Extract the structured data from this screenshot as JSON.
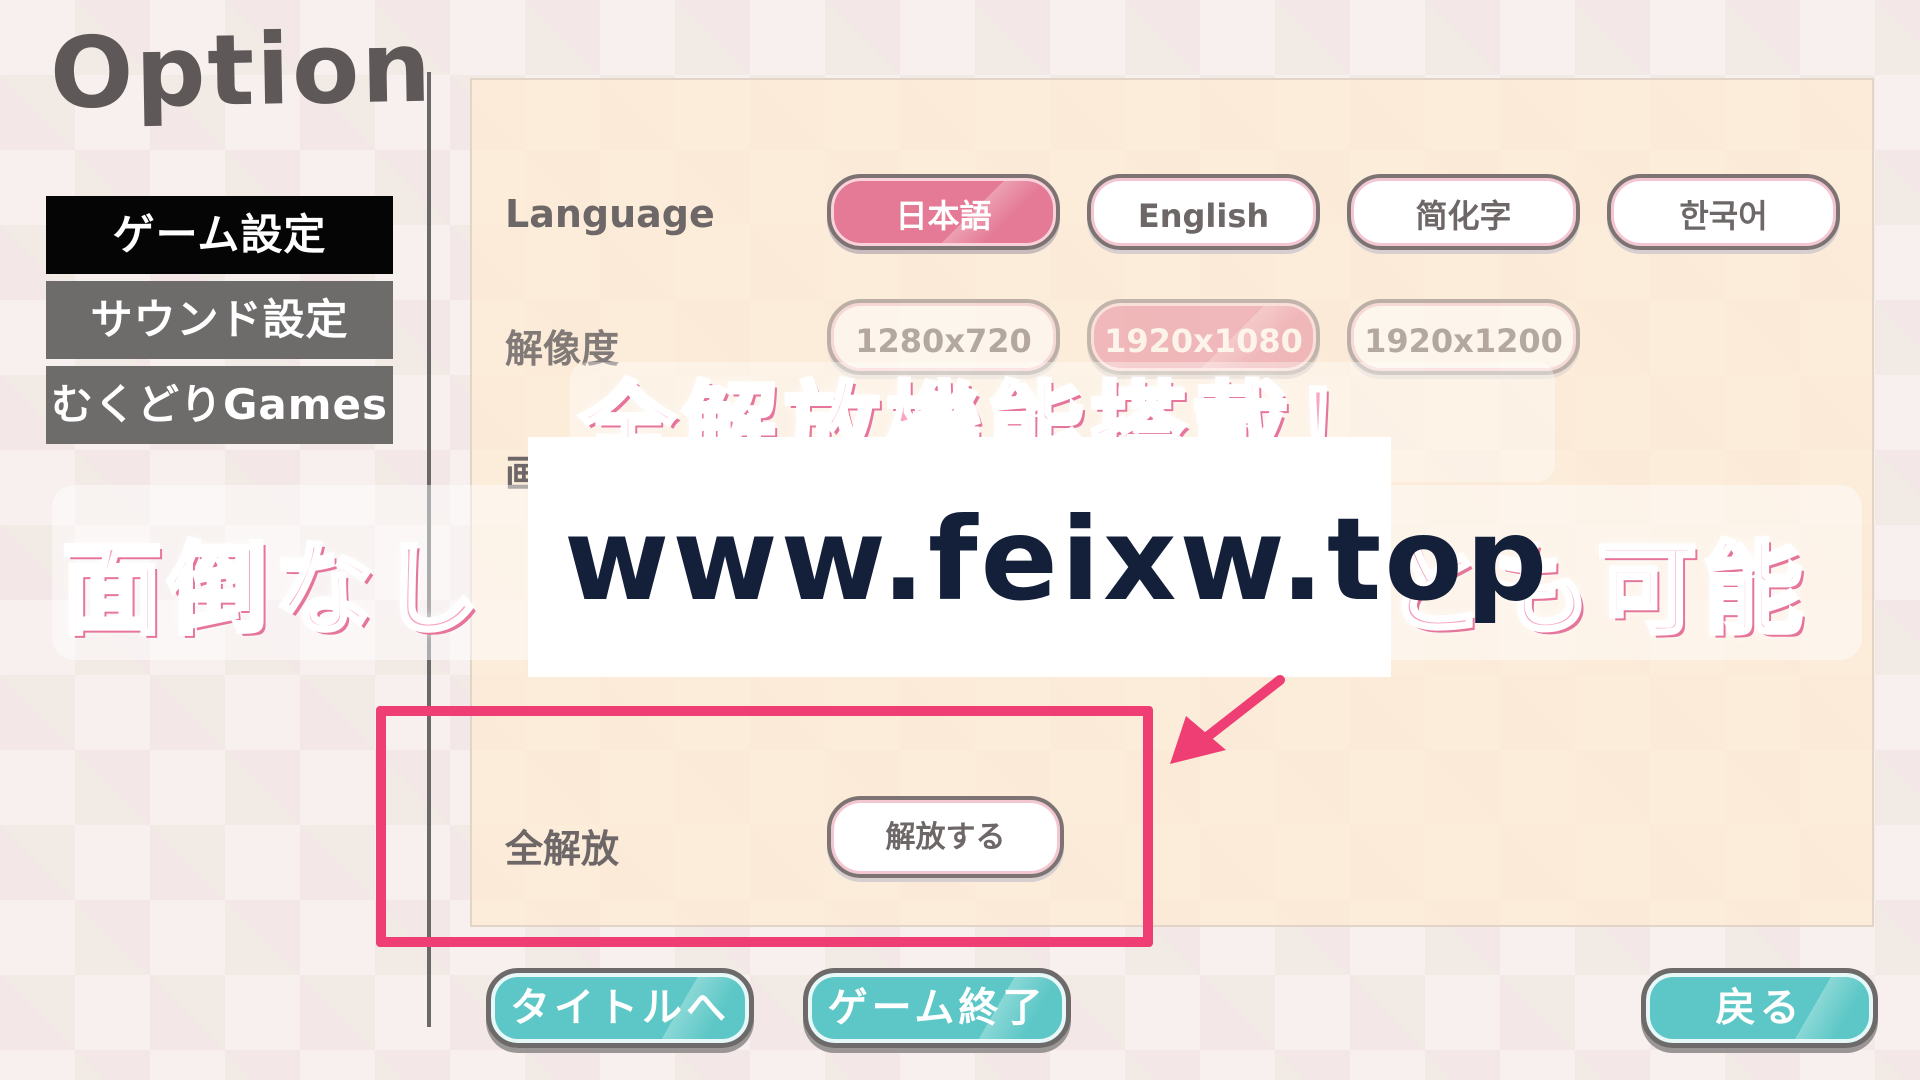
{
  "screen_title": "Option",
  "menu": {
    "items": [
      {
        "label": "ゲーム設定",
        "active": true
      },
      {
        "label": "サウンド設定",
        "active": false
      },
      {
        "label": "むくどりGames",
        "active": false
      }
    ]
  },
  "settings": {
    "language": {
      "label": "Language",
      "options": [
        "日本語",
        "English",
        "简化字",
        "한국어"
      ],
      "selected": "日本語"
    },
    "resolution": {
      "label": "解像度",
      "options": [
        "1280x720",
        "1920x1080",
        "1920x1200"
      ],
      "selected": "1920x1080"
    },
    "screen_mode": {
      "label_partial": "画"
    },
    "unlock_all": {
      "label": "全解放",
      "button_label": "解放する"
    }
  },
  "overlay": {
    "banner_line1": "全解放機能搭載！",
    "banner_line2_left": "面倒なし",
    "banner_line2_right": "とも可能",
    "watermark": "www.feixw.top"
  },
  "bottom_buttons": {
    "to_title": "タイトルへ",
    "quit_game": "ゲーム終了",
    "back": "戻る"
  },
  "colors": {
    "accent_pink": "#e47a95",
    "highlight_red": "#ee3e74",
    "teal_button": "#5cc7c6",
    "menu_active": "#050505",
    "menu_inactive": "#6e6b6b"
  }
}
